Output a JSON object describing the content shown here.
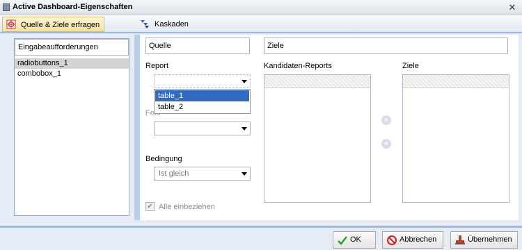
{
  "window": {
    "title": "Active Dashboard-Eigenschaften"
  },
  "tabs": [
    {
      "label": "Quelle & Ziele erfragen",
      "active": true,
      "icon": "target-icon"
    },
    {
      "label": "Kaskaden",
      "active": false,
      "icon": "cascade-icon"
    }
  ],
  "left_panel": {
    "header": "Eingabeaufforderungen",
    "items": [
      {
        "label": "radiobuttons_1",
        "selected": true
      },
      {
        "label": "combobox_1",
        "selected": false
      }
    ]
  },
  "source": {
    "header": "Quelle",
    "report_label": "Report",
    "report_value": "",
    "report_options": [
      {
        "label": "table_1",
        "highlighted": true
      },
      {
        "label": "table_2",
        "highlighted": false
      }
    ],
    "field_label": "Feld",
    "field_value": "",
    "condition_label": "Bedingung",
    "condition_value": "Ist gleich",
    "include_all_label": "Alle einbeziehen",
    "include_all_checked": true
  },
  "targets": {
    "header": "Ziele",
    "candidates_label": "Kandidaten-Reports",
    "targets_label": "Ziele"
  },
  "buttons": {
    "ok": "OK",
    "cancel": "Abbrechen",
    "apply": "Übernehmen"
  }
}
